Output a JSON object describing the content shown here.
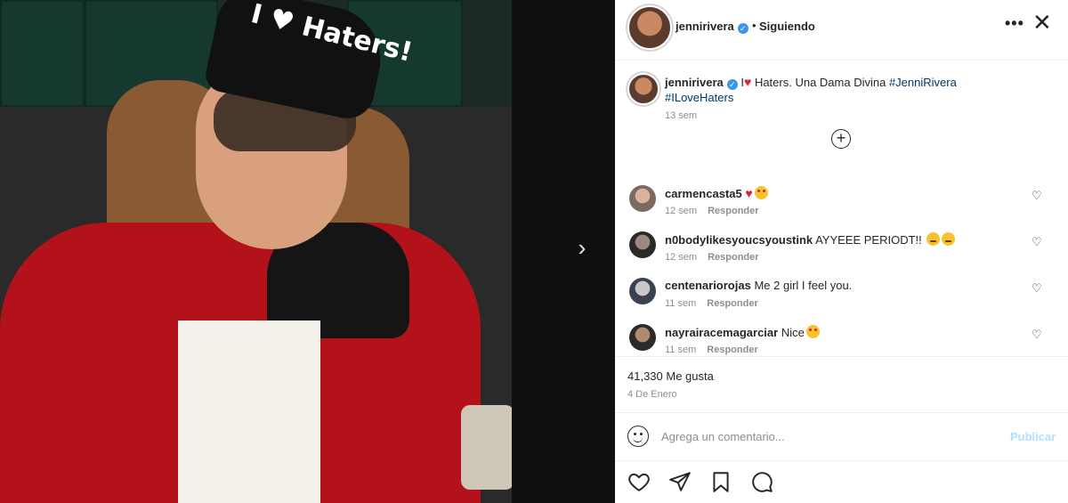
{
  "header": {
    "username": "jennirivera",
    "separator": "•",
    "follow_status": "Siguiendo",
    "more_label": "•••",
    "close_label": "✕"
  },
  "photo": {
    "cap_text": "I ♥ Haters!"
  },
  "navigation": {
    "next_arrow": "›"
  },
  "caption": {
    "username": "jennirivera",
    "prefix": "I",
    "heart": "♥",
    "body": " Haters. Una Dama Divina ",
    "tag1": "#JenniRivera",
    "tag2": "#ILoveHaters",
    "time": "13 sem",
    "load_more": "+"
  },
  "comments": [
    {
      "username": "carmencasta5",
      "text": "",
      "time": "12 sem",
      "reply": "Responder"
    },
    {
      "username": "n0bodylikesyoucsyoustink",
      "text": "AYYEEE PERIODT!!",
      "time": "12 sem",
      "reply": "Responder"
    },
    {
      "username": "centenariorojas",
      "text": "Me 2 girl I feel you.",
      "time": "11 sem",
      "reply": "Responder"
    },
    {
      "username": "nayrairacemagarciar",
      "text": "Nice",
      "time": "11 sem",
      "reply": "Responder"
    }
  ],
  "stats": {
    "likes": "41,330 Me gusta",
    "date": "4 De Enero"
  },
  "add_comment": {
    "placeholder": "Agrega un comentario...",
    "publish": "Publicar"
  },
  "colors": {
    "verified": "#3897f0",
    "heart": "#e0202b",
    "link": "#00376b",
    "publish_disabled": "#b2dffc"
  }
}
